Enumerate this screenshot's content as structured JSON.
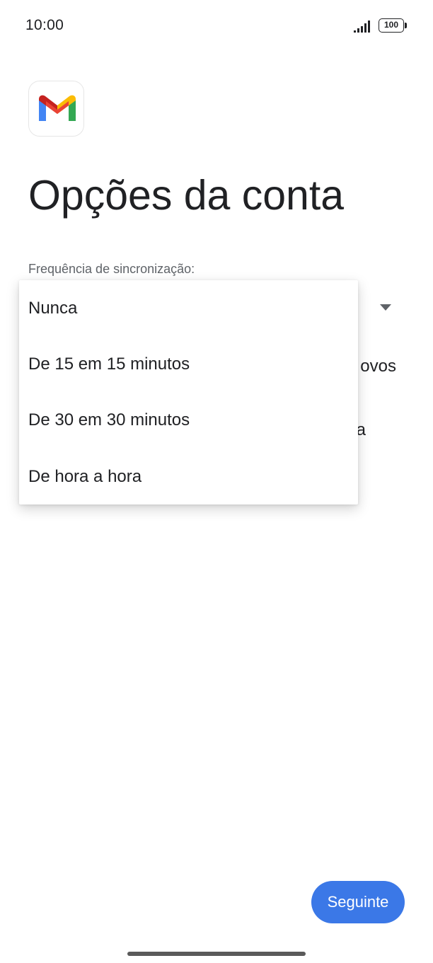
{
  "status_bar": {
    "time": "10:00",
    "battery_level": "100",
    "signal_icon": "cellular-signal-icon",
    "battery_icon": "battery-icon"
  },
  "app": {
    "logo_icon": "gmail-logo-icon",
    "colors": {
      "red": "#ea4335",
      "blue": "#4285f4",
      "green": "#34a853",
      "yellow": "#fbbc04",
      "dark_red": "#c5221f"
    }
  },
  "page": {
    "title": "Opções da conta"
  },
  "sync_frequency": {
    "label": "Frequência de sincronização:",
    "arrow_icon": "dropdown-arrow-icon",
    "options": [
      "Nunca",
      "De 15 em 15 minutos",
      "De 30 em 30 minutos",
      "De hora a hora"
    ]
  },
  "background_text": {
    "line1_fragment": "ovos",
    "line2_fragment": "a"
  },
  "footer": {
    "next_label": "Seguinte",
    "next_color": "#3b78e7"
  }
}
